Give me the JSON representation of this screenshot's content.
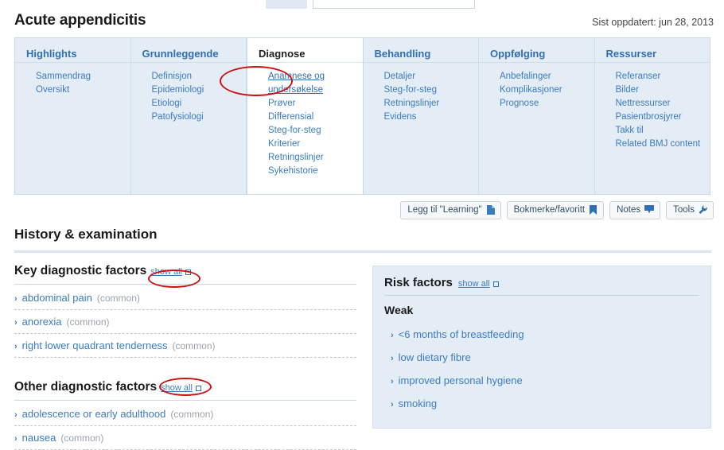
{
  "top_chrome": {
    "chip_label": "",
    "field_value": ""
  },
  "header": {
    "title": "Acute appendicitis",
    "last_updated": "Sist oppdatert: jun 28, 2013"
  },
  "nav": {
    "columns": [
      {
        "heading": "Highlights",
        "active": false,
        "items": [
          {
            "label": "Sammendrag",
            "active": false
          },
          {
            "label": "Oversikt",
            "active": false
          }
        ]
      },
      {
        "heading": "Grunnleggende",
        "active": false,
        "items": [
          {
            "label": "Definisjon",
            "active": false
          },
          {
            "label": "Epidemiologi",
            "active": false
          },
          {
            "label": "Etiologi",
            "active": false
          },
          {
            "label": "Patofysiologi",
            "active": false
          }
        ]
      },
      {
        "heading": "Diagnose",
        "active": true,
        "items": [
          {
            "label": "Anamnese og undersøkelse",
            "active": true
          },
          {
            "label": "Prøver",
            "active": false
          },
          {
            "label": "Differensial",
            "active": false
          },
          {
            "label": "Steg-for-steg",
            "active": false
          },
          {
            "label": "Kriterier",
            "active": false
          },
          {
            "label": "Retningslinjer",
            "active": false
          },
          {
            "label": "Sykehistorie",
            "active": false
          }
        ]
      },
      {
        "heading": "Behandling",
        "active": false,
        "items": [
          {
            "label": "Detaljer",
            "active": false
          },
          {
            "label": "Steg-for-steg",
            "active": false
          },
          {
            "label": "Retningslinjer",
            "active": false
          },
          {
            "label": "Evidens",
            "active": false
          }
        ]
      },
      {
        "heading": "Oppfølging",
        "active": false,
        "items": [
          {
            "label": "Anbefalinger",
            "active": false
          },
          {
            "label": "Komplikasjoner",
            "active": false
          },
          {
            "label": "Prognose",
            "active": false
          }
        ]
      },
      {
        "heading": "Ressurser",
        "active": false,
        "items": [
          {
            "label": "Referanser",
            "active": false
          },
          {
            "label": "Bilder",
            "active": false
          },
          {
            "label": "Nettressurser",
            "active": false
          },
          {
            "label": "Pasientbrosjyrer",
            "active": false
          },
          {
            "label": "Takk til",
            "active": false
          },
          {
            "label": "Related BMJ content",
            "active": false
          }
        ]
      }
    ]
  },
  "toolbar": {
    "buttons": [
      {
        "label": "Legg til \"Learning\"",
        "icon": "page-icon"
      },
      {
        "label": "Bokmerke/favoritt",
        "icon": "bookmark-icon"
      },
      {
        "label": "Notes",
        "icon": "speech-bubble-icon"
      },
      {
        "label": "Tools",
        "icon": "wrench-icon"
      }
    ]
  },
  "main": {
    "section_title": "History & examination",
    "show_all_label": "show all",
    "key_factors": {
      "heading": "Key diagnostic factors",
      "items": [
        {
          "label": "abdominal pain",
          "frequency": "(common)"
        },
        {
          "label": "anorexia",
          "frequency": "(common)"
        },
        {
          "label": "right lower quadrant tenderness",
          "frequency": "(common)"
        }
      ]
    },
    "other_factors": {
      "heading": "Other diagnostic factors",
      "items": [
        {
          "label": "adolescence or early adulthood",
          "frequency": "(common)"
        },
        {
          "label": "nausea",
          "frequency": "(common)"
        }
      ]
    },
    "risk_factors": {
      "heading": "Risk factors",
      "subheading": "Weak",
      "items": [
        {
          "label": "<6 months of breastfeeding"
        },
        {
          "label": "low dietary fibre"
        },
        {
          "label": "improved personal hygiene"
        },
        {
          "label": "smoking"
        }
      ]
    }
  },
  "annotations": {
    "highlight_color": "#cc1111",
    "ellipses": [
      "nav-active-link",
      "key-factors-show-all",
      "other-factors-show-all"
    ]
  },
  "colors": {
    "link": "#3b7cc0",
    "heading": "#2e6fb7",
    "panel_bg": "#e4ecf6",
    "text": "#1a1a1a"
  }
}
